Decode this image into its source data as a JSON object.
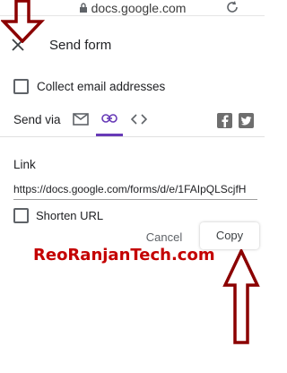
{
  "browser": {
    "url": "docs.google.com"
  },
  "dialog": {
    "title": "Send form",
    "collect_email_label": "Collect email addresses",
    "send_via_label": "Send via",
    "link_heading": "Link",
    "link_url": "https://docs.google.com/forms/d/e/1FAIpQLScjfH",
    "shorten_url_label": "Shorten URL",
    "cancel_label": "Cancel",
    "copy_label": "Copy"
  },
  "watermark": {
    "text": "ReoRanjanTech.com"
  },
  "colors": {
    "accent": "#673ab7",
    "annotation_arrow": "#8b0000",
    "watermark": "#c40000"
  },
  "icons": [
    "lock-icon",
    "reload-icon",
    "close-icon",
    "email-icon",
    "link-icon",
    "embed-icon",
    "facebook-icon",
    "twitter-icon"
  ]
}
